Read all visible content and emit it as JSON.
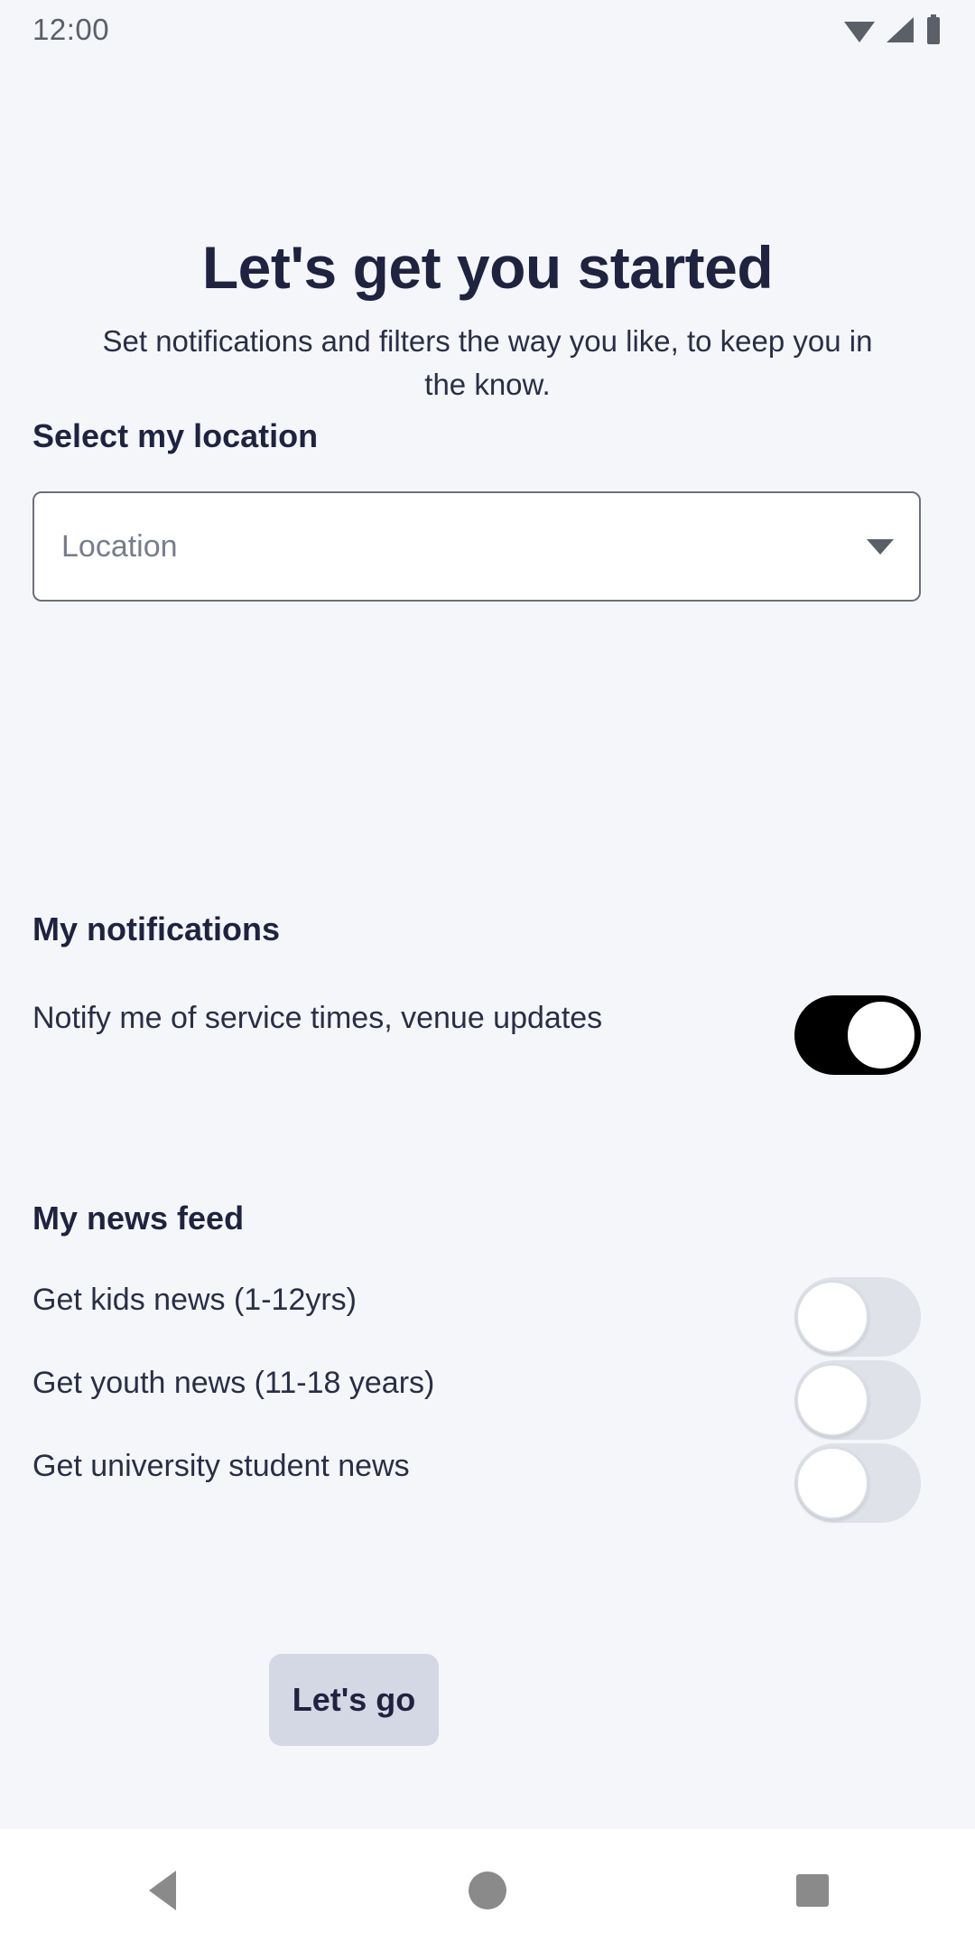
{
  "status_bar": {
    "time": "12:00",
    "icons": [
      "wifi-icon",
      "signal-icon",
      "battery-icon"
    ]
  },
  "header": {
    "title": "Let's get you started",
    "subtitle": "Set notifications and filters the way you like, to keep you in the know."
  },
  "location_section": {
    "label": "Select my location",
    "dropdown": {
      "value": "",
      "placeholder": "Location",
      "caret_icon": "chevron-down-icon"
    }
  },
  "notifications_section": {
    "label": "My notifications",
    "items": [
      {
        "label": "Notify me of service times, venue updates",
        "state": "on"
      }
    ]
  },
  "news_feed_section": {
    "label": "My news feed",
    "items": [
      {
        "label": "Get kids news (1-12yrs)",
        "state": "off"
      },
      {
        "label": "Get youth news (11-18 years)",
        "state": "off"
      },
      {
        "label": "Get university student news",
        "state": "off"
      }
    ]
  },
  "cta": {
    "label": "Let's go"
  },
  "navbar": {
    "back_label": "Back",
    "home_label": "Home",
    "recents_label": "Recents"
  },
  "colors": {
    "background": "#f4f6fa",
    "heading": "#1f2340",
    "body_text": "#2a2e45",
    "placeholder": "#787d8c",
    "field_border": "#6c7079",
    "toggle_on": "#000000",
    "toggle_off_track": "#dfe2e9",
    "cta_background": "#d4d7e4",
    "navbar_background": "#ffffff",
    "navbar_icon": "#8a8a8a"
  }
}
